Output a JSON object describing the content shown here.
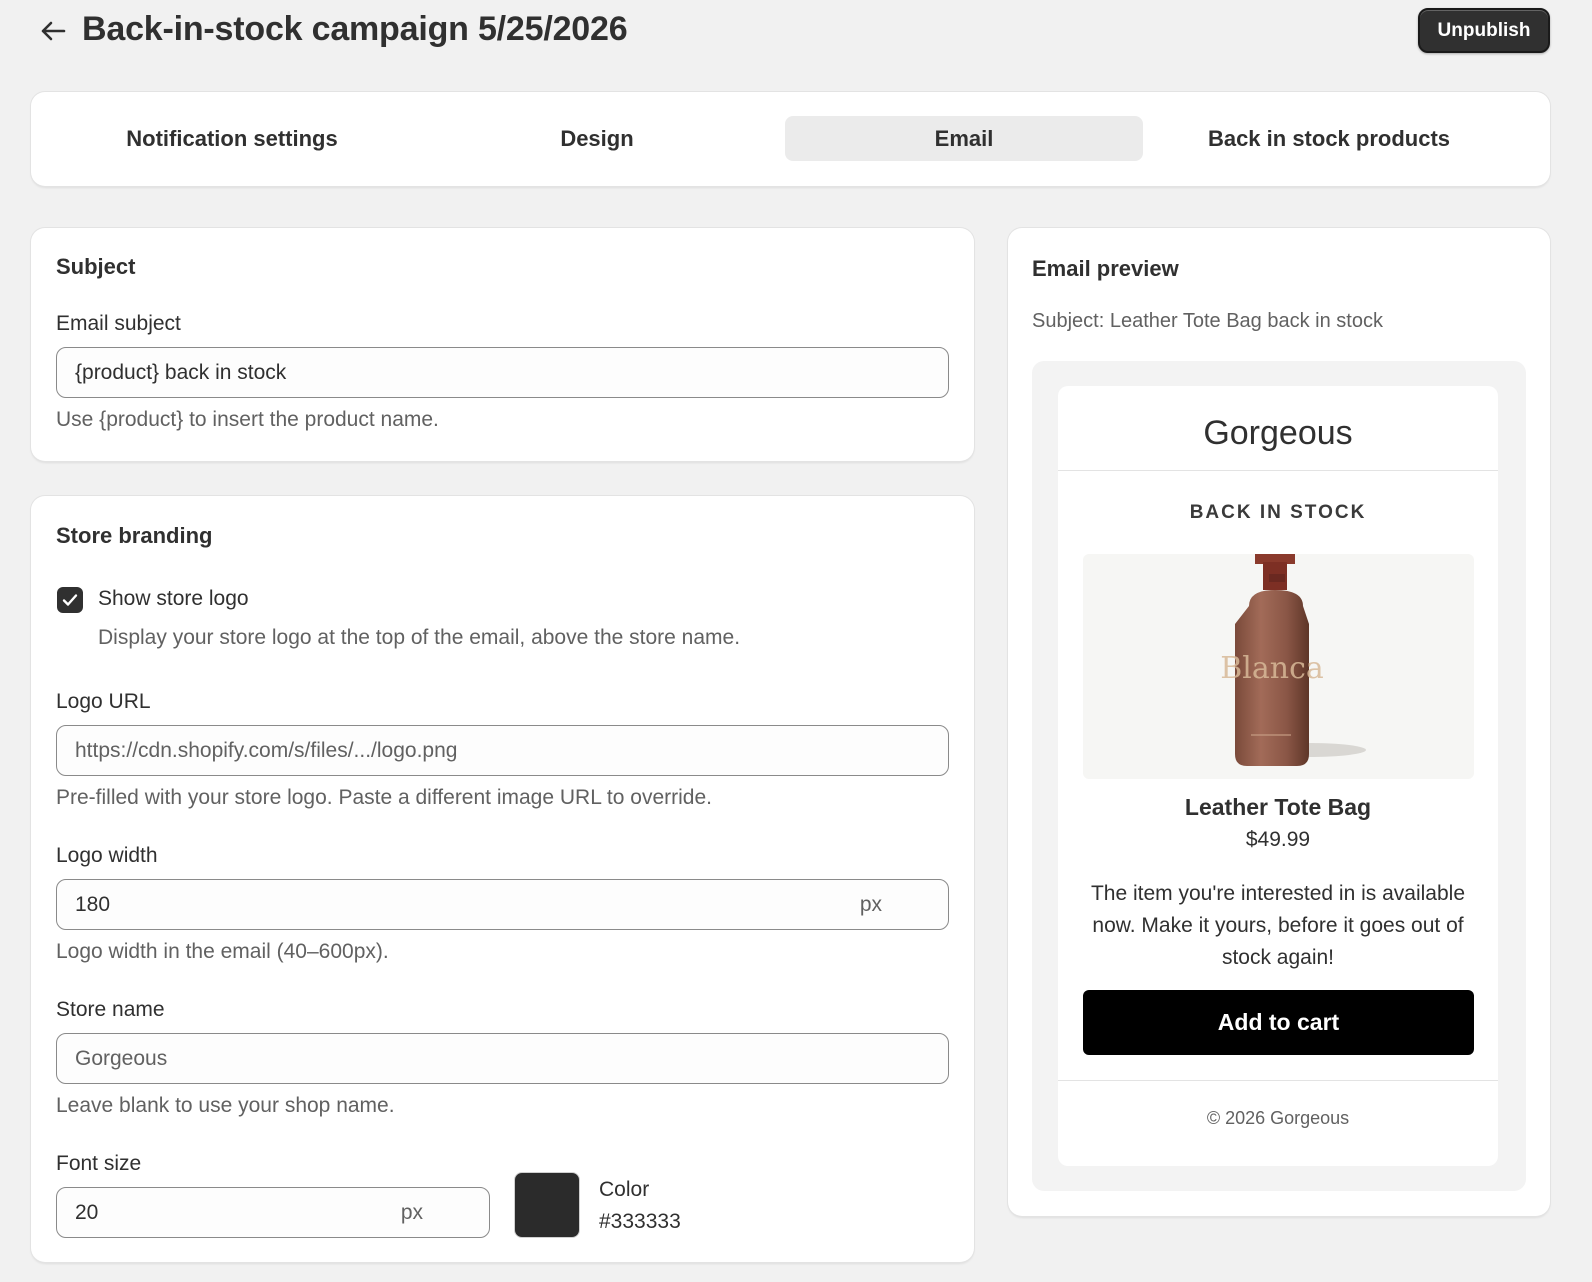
{
  "header": {
    "title": "Back-in-stock campaign 5/25/2026",
    "unpublish_label": "Unpublish"
  },
  "tabs": [
    {
      "label": "Notification settings",
      "active": false
    },
    {
      "label": "Design",
      "active": false
    },
    {
      "label": "Email",
      "active": true
    },
    {
      "label": "Back in stock products",
      "active": false
    }
  ],
  "subject_card": {
    "title": "Subject",
    "email_subject_label": "Email subject",
    "email_subject_value": "{product} back in stock",
    "help": "Use {product} to insert the product name."
  },
  "branding_card": {
    "title": "Store branding",
    "show_logo_label": "Show store logo",
    "show_logo_checked": true,
    "show_logo_help": "Display your store logo at the top of the email, above the store name.",
    "logo_url_label": "Logo URL",
    "logo_url_value": "https://cdn.shopify.com/s/files/.../logo.png",
    "logo_url_help": "Pre-filled with your store logo. Paste a different image URL to override.",
    "logo_width_label": "Logo width",
    "logo_width_value": "180",
    "logo_width_suffix": "px",
    "logo_width_help": "Logo width in the email (40–600px).",
    "store_name_label": "Store name",
    "store_name_value": "Gorgeous",
    "store_name_help": "Leave blank to use your shop name.",
    "font_size_label": "Font size",
    "font_size_value": "20",
    "font_size_suffix": "px",
    "color_label": "Color",
    "color_value": "#333333"
  },
  "preview_card": {
    "title": "Email preview",
    "subject_line": "Subject: Leather Tote Bag back in stock",
    "email": {
      "store_name": "Gorgeous",
      "heading": "BACK IN STOCK",
      "bottle_text": "Blanca",
      "product_name": "Leather Tote Bag",
      "product_price": "$49.99",
      "message": "The item you're interested in is available now. Make it yours, before it goes out of stock again!",
      "cta_label": "Add to cart",
      "footer": "© 2026 Gorgeous"
    }
  },
  "colors": {
    "primary_button": "#303030",
    "page_bg": "#f1f1f1",
    "active_tab_bg": "#ebebeb",
    "swatch": "#2b2b2b",
    "cta_bg": "#000000"
  },
  "icons": {
    "back": "arrow-left-icon",
    "checkbox": "checkmark-icon"
  }
}
